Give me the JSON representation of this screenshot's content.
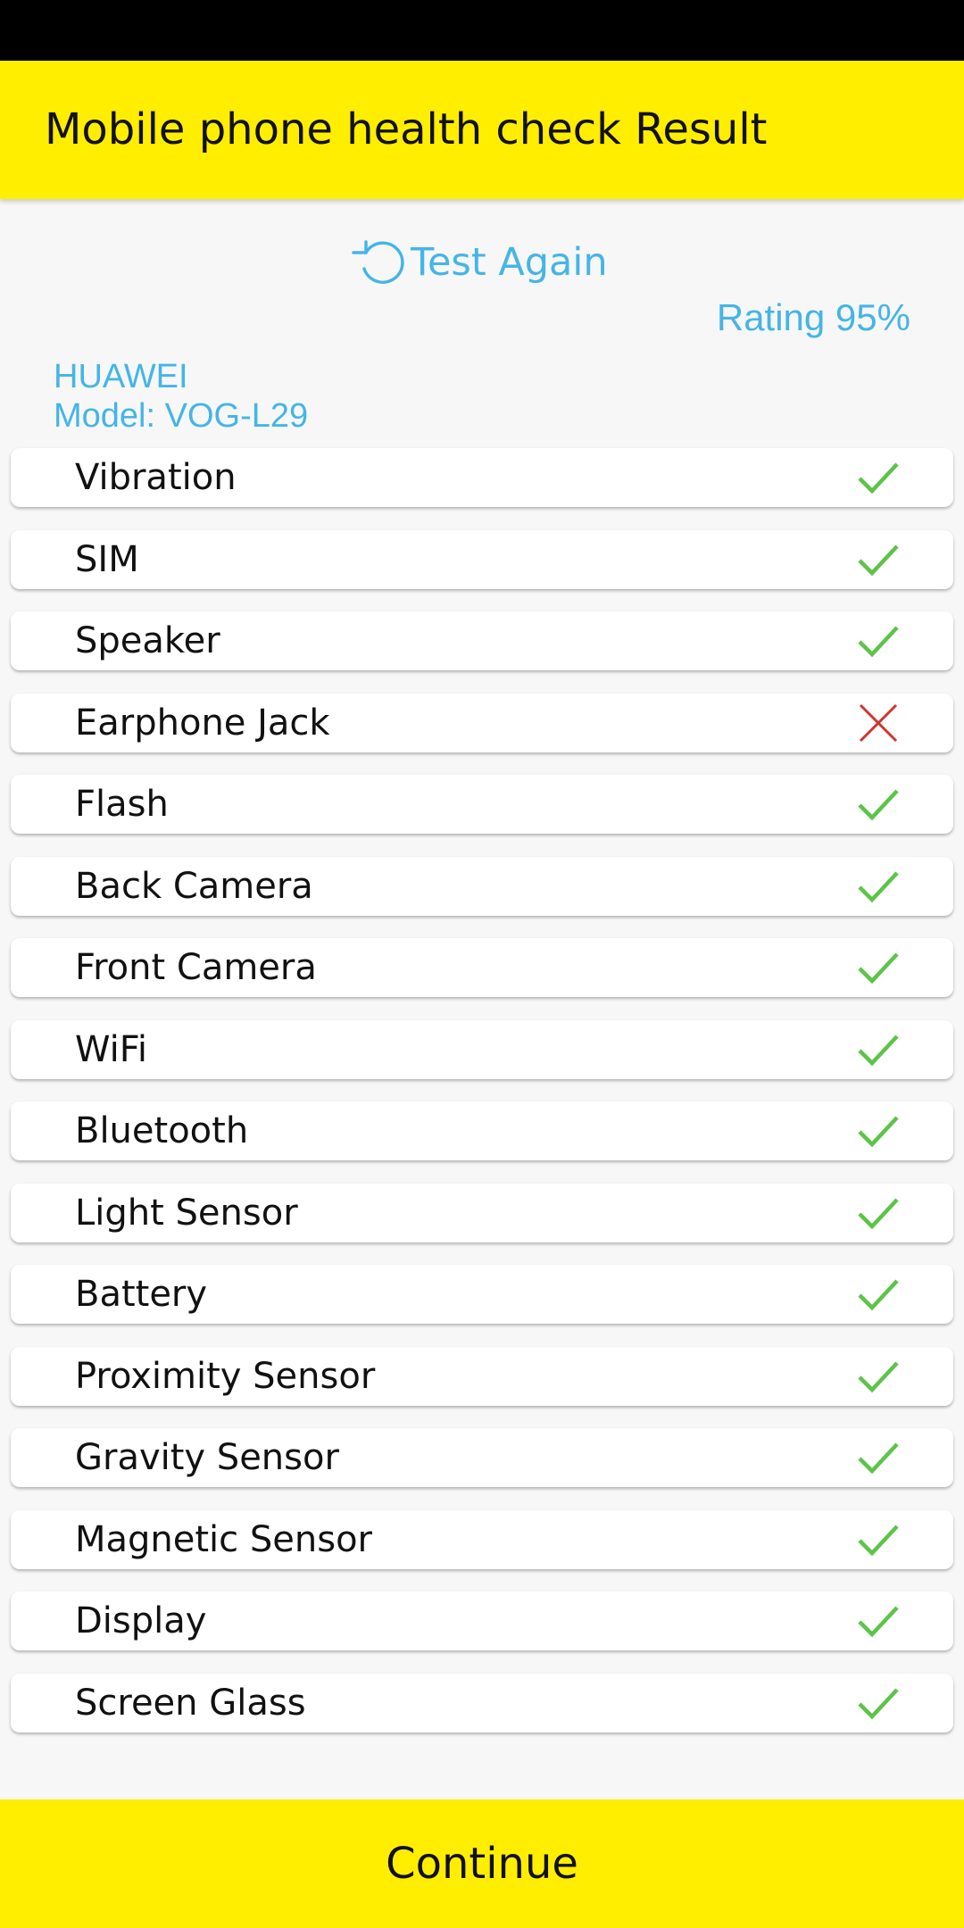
{
  "app_bar": {
    "title": "Mobile phone health check Result"
  },
  "test_again": {
    "label": "Test Again",
    "icon": "refresh-icon"
  },
  "rating": {
    "text": "Rating 95%"
  },
  "device": {
    "brand": "HUAWEI",
    "model": "Model: VOG-L29"
  },
  "colors": {
    "accent": "#ffee00",
    "link": "#45b5e6",
    "pass": "#5cc448",
    "fail": "#d0342c"
  },
  "checks": [
    {
      "label": "Vibration",
      "status": "pass"
    },
    {
      "label": "SIM",
      "status": "pass"
    },
    {
      "label": "Speaker",
      "status": "pass"
    },
    {
      "label": "Earphone Jack",
      "status": "fail"
    },
    {
      "label": "Flash",
      "status": "pass"
    },
    {
      "label": "Back Camera",
      "status": "pass"
    },
    {
      "label": "Front Camera",
      "status": "pass"
    },
    {
      "label": "WiFi",
      "status": "pass"
    },
    {
      "label": "Bluetooth",
      "status": "pass"
    },
    {
      "label": "Light Sensor",
      "status": "pass"
    },
    {
      "label": "Battery",
      "status": "pass"
    },
    {
      "label": "Proximity Sensor",
      "status": "pass"
    },
    {
      "label": "Gravity Sensor",
      "status": "pass"
    },
    {
      "label": "Magnetic Sensor",
      "status": "pass"
    },
    {
      "label": "Display",
      "status": "pass"
    },
    {
      "label": "Screen Glass",
      "status": "pass"
    }
  ],
  "continue": {
    "label": "Continue"
  }
}
